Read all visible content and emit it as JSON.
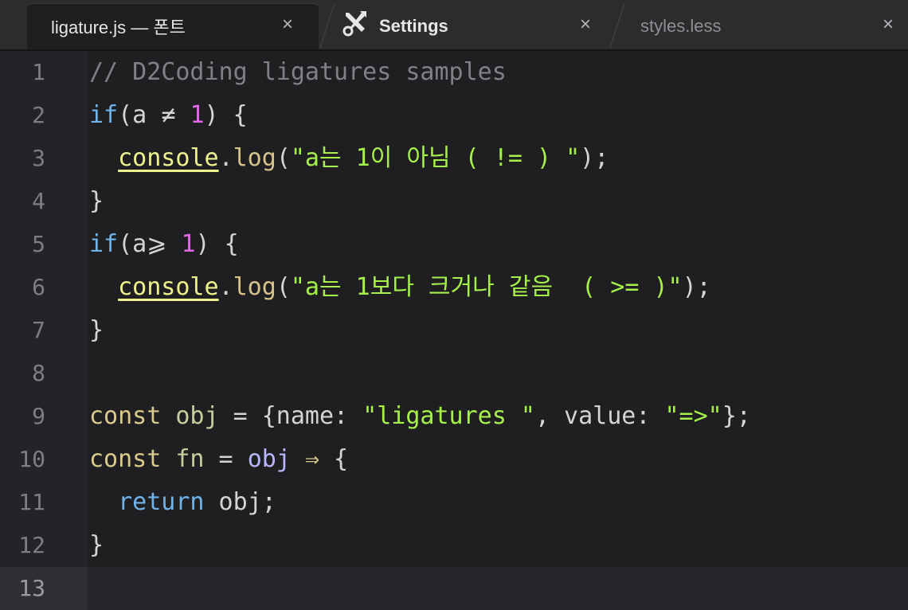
{
  "tabs": [
    {
      "label": "ligature.js — 폰트",
      "active": true,
      "close": "×"
    },
    {
      "label": "Settings",
      "icon": "tools-icon",
      "active": false,
      "close": "×"
    },
    {
      "label": "styles.less",
      "active": false,
      "close": "×"
    }
  ],
  "gutter": {
    "line_numbers": [
      "1",
      "2",
      "3",
      "4",
      "5",
      "6",
      "7",
      "8",
      "9",
      "10",
      "11",
      "12",
      "13"
    ],
    "current_line": "13"
  },
  "code": {
    "lines": [
      [
        {
          "t": "// D2Coding ligatures samples",
          "k": "comment"
        }
      ],
      [
        {
          "t": "if",
          "k": "keyword"
        },
        {
          "t": "(a ",
          "k": "plain"
        },
        {
          "t": "≠",
          "k": "plain"
        },
        {
          "t": " ",
          "k": "plain"
        },
        {
          "t": "1",
          "k": "num"
        },
        {
          "t": ") {",
          "k": "plain"
        }
      ],
      [
        {
          "t": "  ",
          "k": "plain"
        },
        {
          "t": "console",
          "k": "builtin"
        },
        {
          "t": ".",
          "k": "plain"
        },
        {
          "t": "log",
          "k": "func"
        },
        {
          "t": "(",
          "k": "plain"
        },
        {
          "t": "\"a는 1이 아님 ( != ) \"",
          "k": "str"
        },
        {
          "t": ");",
          "k": "plain"
        }
      ],
      [
        {
          "t": "}",
          "k": "plain"
        }
      ],
      [
        {
          "t": "if",
          "k": "keyword"
        },
        {
          "t": "(a",
          "k": "plain"
        },
        {
          "t": "⩾",
          "k": "plain"
        },
        {
          "t": " ",
          "k": "plain"
        },
        {
          "t": "1",
          "k": "num"
        },
        {
          "t": ") {",
          "k": "plain"
        }
      ],
      [
        {
          "t": "  ",
          "k": "plain"
        },
        {
          "t": "console",
          "k": "builtin"
        },
        {
          "t": ".",
          "k": "plain"
        },
        {
          "t": "log",
          "k": "func"
        },
        {
          "t": "(",
          "k": "plain"
        },
        {
          "t": "\"a는 1보다 크거나 같음  ( >= )\"",
          "k": "str"
        },
        {
          "t": ");",
          "k": "plain"
        }
      ],
      [
        {
          "t": "}",
          "k": "plain"
        }
      ],
      [
        {
          "t": "",
          "k": "plain"
        }
      ],
      [
        {
          "t": "const",
          "k": "const"
        },
        {
          "t": " ",
          "k": "plain"
        },
        {
          "t": "obj",
          "k": "var"
        },
        {
          "t": " = {name: ",
          "k": "plain"
        },
        {
          "t": "\"ligatures \"",
          "k": "str"
        },
        {
          "t": ", value: ",
          "k": "plain"
        },
        {
          "t": "\"=>\"",
          "k": "str"
        },
        {
          "t": "};",
          "k": "plain"
        }
      ],
      [
        {
          "t": "const",
          "k": "const"
        },
        {
          "t": " ",
          "k": "plain"
        },
        {
          "t": "fn",
          "k": "var"
        },
        {
          "t": " = ",
          "k": "plain"
        },
        {
          "t": "obj",
          "k": "obj"
        },
        {
          "t": " ",
          "k": "plain"
        },
        {
          "t": "⇒",
          "k": "const"
        },
        {
          "t": " {",
          "k": "plain"
        }
      ],
      [
        {
          "t": "  ",
          "k": "plain"
        },
        {
          "t": "return",
          "k": "keyword"
        },
        {
          "t": " obj;",
          "k": "plain"
        }
      ],
      [
        {
          "t": "}",
          "k": "plain"
        }
      ],
      [
        {
          "t": "",
          "k": "plain"
        }
      ]
    ]
  }
}
